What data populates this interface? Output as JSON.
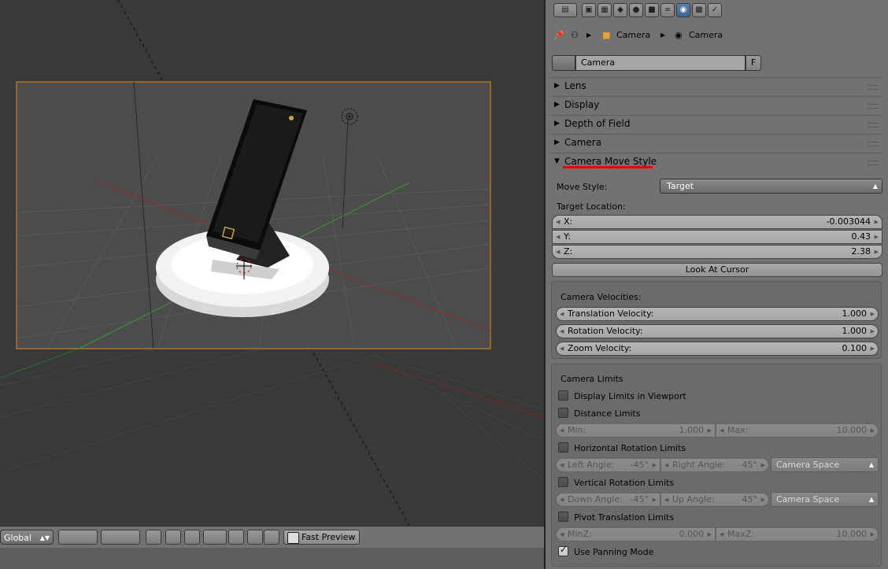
{
  "viewport": {
    "header": {
      "orientation": "Global",
      "fast_preview": "Fast Preview"
    }
  },
  "properties": {
    "breadcrumb": {
      "object": "Camera",
      "data": "Camera"
    },
    "datablock": {
      "name": "Camera",
      "fake_user": "F"
    },
    "collapsed_panels": [
      "Lens",
      "Display",
      "Depth of Field",
      "Camera"
    ],
    "camera_move_style": {
      "title": "Camera Move Style",
      "move_style_label": "Move Style:",
      "move_style_value": "Target",
      "target_location_label": "Target Location:",
      "x_label": "X:",
      "x_value": "-0.003044",
      "y_label": "Y:",
      "y_value": "0.43",
      "z_label": "Z:",
      "z_value": "2.38",
      "look_at_cursor": "Look At Cursor"
    },
    "velocities": {
      "title": "Camera Velocities:",
      "translation_label": "Translation Velocity:",
      "translation_value": "1.000",
      "rotation_label": "Rotation Velocity:",
      "rotation_value": "1.000",
      "zoom_label": "Zoom Velocity:",
      "zoom_value": "0.100"
    },
    "limits": {
      "title": "Camera Limits",
      "display_in_viewport": "Display Limits in Viewport",
      "distance_limits": "Distance Limits",
      "min_label": "Min:",
      "min_value": "1.000",
      "max_label": "Max:",
      "max_value": "10.000",
      "horizontal_rotation": "Horizontal Rotation Limits",
      "left_angle_label": "Left Angle:",
      "left_angle_value": "-45°",
      "right_angle_label": "Right Angle:",
      "right_angle_value": "45°",
      "h_space": "Camera Space",
      "vertical_rotation": "Vertical Rotation Limits",
      "down_angle_label": "Down Angle:",
      "down_angle_value": "-45°",
      "up_angle_label": "Up Angle:",
      "up_angle_value": "45°",
      "v_space": "Camera Space",
      "pivot_translation": "Pivot Translation Limits",
      "minz_label": "MinZ:",
      "minz_value": "0.000",
      "maxz_label": "MaxZ:",
      "maxz_value": "10.000",
      "use_panning": "Use Panning Mode"
    }
  }
}
